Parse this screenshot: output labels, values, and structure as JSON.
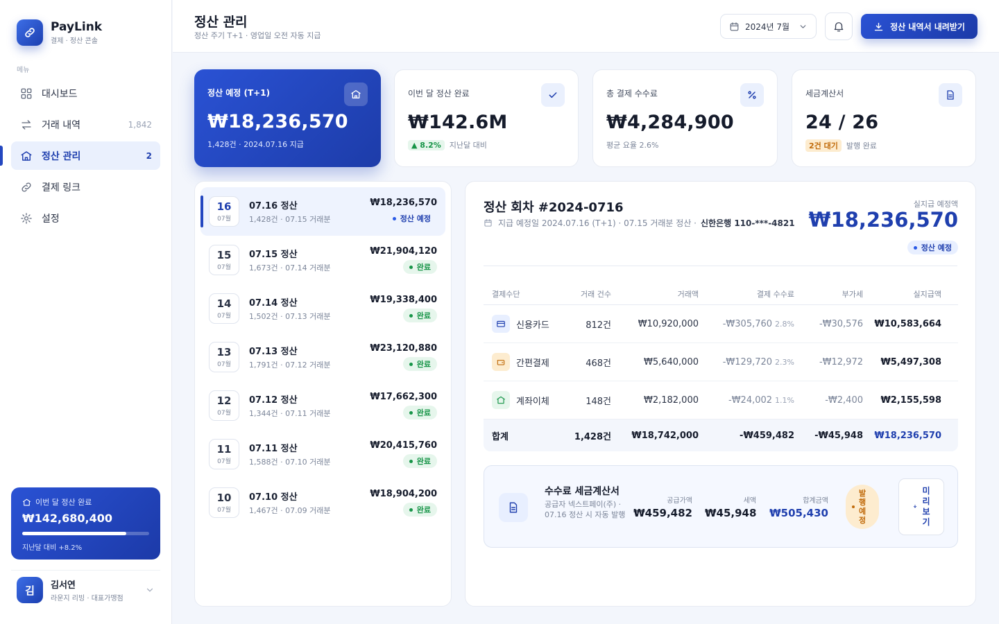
{
  "brand": {
    "name": "PayLink",
    "subtitle": "결제 · 정산 콘솔"
  },
  "sidebar": {
    "menu_title": "메뉴",
    "items": [
      {
        "label": "대시보드",
        "count": "",
        "icon": "grid-icon"
      },
      {
        "label": "거래 내역",
        "count": "1,842",
        "icon": "transfer-icon"
      },
      {
        "label": "정산 관리",
        "count": "2",
        "icon": "bank-icon"
      },
      {
        "label": "결제 링크",
        "count": "",
        "icon": "link-icon"
      },
      {
        "label": "설정",
        "count": "",
        "icon": "gear-icon"
      }
    ],
    "summary": {
      "title": "이번 달 정산 완료",
      "amount": "₩142,680,400",
      "progress": 0.82,
      "footer": "지난달 대비 +8.2%"
    },
    "user": {
      "initial": "김",
      "name": "김서연",
      "role": "라운지 리빙 · 대표가맹점"
    }
  },
  "header": {
    "title": "정산 관리",
    "subtitle": "정산 주기 T+1 · 영업일 오전 자동 지급",
    "month": "2024년 7월",
    "download_label": "정산 내역서 내려받기"
  },
  "kpis": [
    {
      "label": "정산 예정 (T+1)",
      "value": "₩18,236,570",
      "foot": "1,428건 · 2024.07.16 지급",
      "icon": "bank-icon"
    },
    {
      "label": "이번 달 정산 완료",
      "value": "₩142.6M",
      "chip": "▲ 8.2%",
      "foot": "지난달 대비",
      "icon": "check-icon"
    },
    {
      "label": "총 결제 수수료",
      "value": "₩4,284,900",
      "foot": "평균 요율 2.6%",
      "icon": "percent-icon"
    },
    {
      "label": "세금계산서",
      "value": "24 / 26",
      "chip": "2건 대기",
      "foot": "발행 완료",
      "icon": "document-icon"
    }
  ],
  "settlements": [
    {
      "day": "16",
      "month": "07월",
      "title": "07.16 정산",
      "sub": "1,428건 · 07.15 거래분",
      "amount": "₩18,236,570",
      "status": "정산 예정",
      "kind": "plan"
    },
    {
      "day": "15",
      "month": "07월",
      "title": "07.15 정산",
      "sub": "1,673건 · 07.14 거래분",
      "amount": "₩21,904,120",
      "status": "완료",
      "kind": "done"
    },
    {
      "day": "14",
      "month": "07월",
      "title": "07.14 정산",
      "sub": "1,502건 · 07.13 거래분",
      "amount": "₩19,338,400",
      "status": "완료",
      "kind": "done"
    },
    {
      "day": "13",
      "month": "07월",
      "title": "07.13 정산",
      "sub": "1,791건 · 07.12 거래분",
      "amount": "₩23,120,880",
      "status": "완료",
      "kind": "done"
    },
    {
      "day": "12",
      "month": "07월",
      "title": "07.12 정산",
      "sub": "1,344건 · 07.11 거래분",
      "amount": "₩17,662,300",
      "status": "완료",
      "kind": "done"
    },
    {
      "day": "11",
      "month": "07월",
      "title": "07.11 정산",
      "sub": "1,588건 · 07.10 거래분",
      "amount": "₩20,415,760",
      "status": "완료",
      "kind": "done"
    },
    {
      "day": "10",
      "month": "07월",
      "title": "07.10 정산",
      "sub": "1,467건 · 07.09 거래분",
      "amount": "₩18,904,200",
      "status": "완료",
      "kind": "done"
    }
  ],
  "detail": {
    "title": "정산 회차 #2024-0716",
    "meta": "지급 예정일 2024.07.16 (T+1) · 07.15 거래분 정산 ·",
    "bank": "신한은행 110-***-4821",
    "net_label": "실지급 예정액",
    "net_amount": "₩18,236,570",
    "status": "정산 예정",
    "table": {
      "headers": [
        "결제수단",
        "거래 건수",
        "거래액",
        "결제 수수료",
        "부가세",
        "실지급액"
      ],
      "rows": [
        {
          "method": "신용카드",
          "icon": "card-icon",
          "count": "812건",
          "gross": "₩10,920,000",
          "fee": "-₩305,760",
          "rate": "2.8%",
          "vat": "-₩30,576",
          "net": "₩10,583,664"
        },
        {
          "method": "간편결제",
          "icon": "wallet-icon",
          "count": "468건",
          "gross": "₩5,640,000",
          "fee": "-₩129,720",
          "rate": "2.3%",
          "vat": "-₩12,972",
          "net": "₩5,497,308"
        },
        {
          "method": "계좌이체",
          "icon": "bank-icon",
          "count": "148건",
          "gross": "₩2,182,000",
          "fee": "-₩24,002",
          "rate": "1.1%",
          "vat": "-₩2,400",
          "net": "₩2,155,598"
        }
      ],
      "total": {
        "label": "합계",
        "count": "1,428건",
        "gross": "₩18,742,000",
        "fee": "-₩459,482",
        "vat": "-₩45,948",
        "net": "₩18,236,570"
      }
    },
    "invoice": {
      "title": "수수료 세금계산서",
      "desc": "공급자 넥스트페이(주) · 07.16 정산 시 자동 발행",
      "supply_label": "공급가액",
      "supply": "₩459,482",
      "tax_label": "세액",
      "tax": "₩45,948",
      "total_label": "합계금액",
      "total": "₩505,430",
      "status": "발행예정",
      "preview_label": "미리보기"
    }
  },
  "colors": {
    "accent": "#2447c0",
    "success": "#169447",
    "warning": "#c06a0a"
  }
}
